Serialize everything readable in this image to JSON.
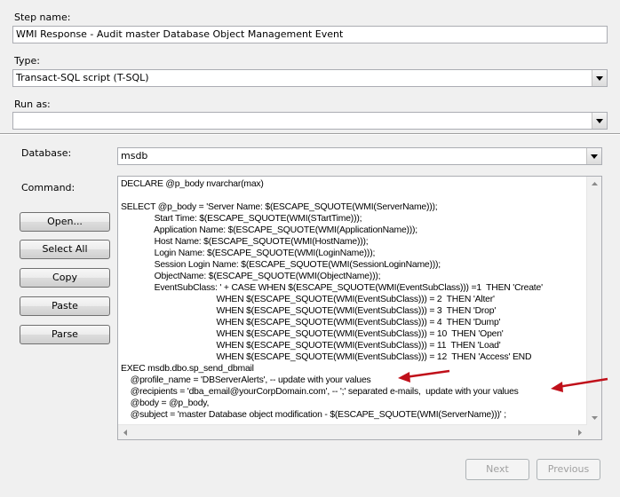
{
  "step_name": {
    "label": "Step name:",
    "value": "WMI Response - Audit master Database Object Management Event"
  },
  "type": {
    "label": "Type:",
    "value": "Transact-SQL script (T-SQL)"
  },
  "run_as": {
    "label": "Run as:",
    "value": ""
  },
  "database": {
    "label": "Database:",
    "value": "msdb"
  },
  "command": {
    "label": "Command:",
    "lines": [
      "DECLARE @p_body nvarchar(max)",
      "",
      "SELECT @p_body = 'Server Name: $(ESCAPE_SQUOTE(WMI(ServerName)));",
      "              Start Time: $(ESCAPE_SQUOTE(WMI(STartTime)));",
      "              Application Name: $(ESCAPE_SQUOTE(WMI(ApplicationName)));",
      "              Host Name: $(ESCAPE_SQUOTE(WMI(HostName)));",
      "              Login Name: $(ESCAPE_SQUOTE(WMI(LoginName)));",
      "              Session Login Name: $(ESCAPE_SQUOTE(WMI(SessionLoginName)));",
      "              ObjectName: $(ESCAPE_SQUOTE(WMI(ObjectName)));",
      "              EventSubClass: ' + CASE WHEN $(ESCAPE_SQUOTE(WMI(EventSubClass))) =1  THEN 'Create'",
      "                                        WHEN $(ESCAPE_SQUOTE(WMI(EventSubClass))) = 2  THEN 'Alter'",
      "                                        WHEN $(ESCAPE_SQUOTE(WMI(EventSubClass))) = 3  THEN 'Drop'",
      "                                        WHEN $(ESCAPE_SQUOTE(WMI(EventSubClass))) = 4  THEN 'Dump'",
      "                                        WHEN $(ESCAPE_SQUOTE(WMI(EventSubClass))) = 10  THEN 'Open'",
      "                                        WHEN $(ESCAPE_SQUOTE(WMI(EventSubClass))) = 11  THEN 'Load'",
      "                                        WHEN $(ESCAPE_SQUOTE(WMI(EventSubClass))) = 12  THEN 'Access' END",
      "EXEC msdb.dbo.sp_send_dbmail",
      "    @profile_name = 'DBServerAlerts', -- update with your values",
      "    @recipients = 'dba_email@yourCorpDomain.com', -- ';' separated e-mails,  update with your values",
      "    @body = @p_body,",
      "    @subject = 'master Database object modification - $(ESCAPE_SQUOTE(WMI(ServerName)))' ;"
    ]
  },
  "buttons": {
    "open": "Open...",
    "select_all": "Select All",
    "copy": "Copy",
    "paste": "Paste",
    "parse": "Parse",
    "next": "Next",
    "previous": "Previous"
  },
  "colors": {
    "annotation_arrow": "#c0101a",
    "background": "#f0f0f0"
  }
}
